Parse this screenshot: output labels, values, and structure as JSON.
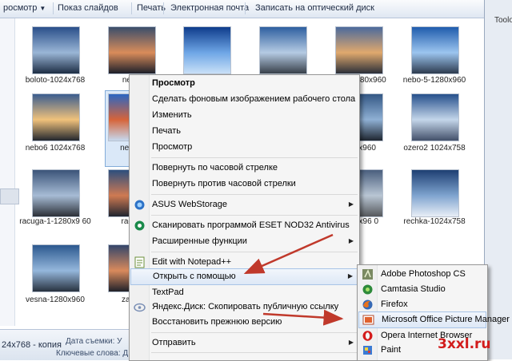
{
  "toolbar": {
    "items": [
      "росмотр",
      "Показ слайдов",
      "Печать",
      "Электронная почта",
      "Записать на оптический диск"
    ]
  },
  "right_pane": {
    "label": "Toolo"
  },
  "thumbnails": [
    {
      "caption": "boloto-1024x768"
    },
    {
      "caption": "nebo"
    },
    {
      "caption": ""
    },
    {
      "caption": ""
    },
    {
      "caption": "nebo-1280x960"
    },
    {
      "caption": "nebo-5-1280x960"
    },
    {
      "caption": "nebo6 1024x768"
    },
    {
      "caption": "nebo7"
    },
    {
      "caption": "1280x960"
    },
    {
      "caption": "ozero2 1024x758"
    },
    {
      "caption": "racuga-1-1280x9 60"
    },
    {
      "caption": "racug"
    },
    {
      "caption": "-1280x96 0"
    },
    {
      "caption": "rechka-1024x758"
    },
    {
      "caption": "vesna-1280x960"
    },
    {
      "caption": "zaket"
    }
  ],
  "details": {
    "name": "24x768 - копия",
    "date_label": "Дата съемки: У",
    "keywords_label": "Ключевые слова: Д"
  },
  "context_menu": {
    "items": [
      {
        "label": "Просмотр",
        "bold": true
      },
      {
        "label": "Сделать фоновым изображением рабочего стола"
      },
      {
        "label": "Изменить"
      },
      {
        "label": "Печать"
      },
      {
        "label": "Просмотр"
      },
      {
        "label": "Повернуть по часовой стрелке"
      },
      {
        "label": "Повернуть против часовой стрелки"
      },
      {
        "label": "ASUS WebStorage",
        "icon": "asus-webstorage-icon"
      },
      {
        "label": "Сканировать программой ESET NOD32 Antivirus",
        "icon": "eset-icon"
      },
      {
        "label": "Расширенные функции",
        "icon": "eset-advanced-icon"
      },
      {
        "label": "Edit with Notepad++",
        "icon": "notepad-plus-icon"
      },
      {
        "label": "Открыть с помощью"
      },
      {
        "label": "TextPad"
      },
      {
        "label": "Яндекс.Диск: Скопировать публичную ссылку",
        "icon": "yandex-disk-icon"
      },
      {
        "label": "Восстановить прежнюю версию"
      },
      {
        "label": "Отправить"
      }
    ]
  },
  "submenu": {
    "items": [
      {
        "label": "Adobe Photoshop CS",
        "icon": "photoshop-icon"
      },
      {
        "label": "Camtasia Studio",
        "icon": "camtasia-icon"
      },
      {
        "label": "Firefox",
        "icon": "firefox-icon"
      },
      {
        "label": "Microsoft Office Picture Manager",
        "icon": "picture-manager-icon"
      },
      {
        "label": "Opera Internet Browser",
        "icon": "opera-icon"
      },
      {
        "label": "Paint",
        "icon": "paint-icon"
      }
    ]
  },
  "watermark": {
    "text": "3xxl.ru"
  },
  "colors": {
    "arrow": "#c0392b",
    "watermark": "#d21c1c",
    "highlight": "#dde8f6"
  }
}
